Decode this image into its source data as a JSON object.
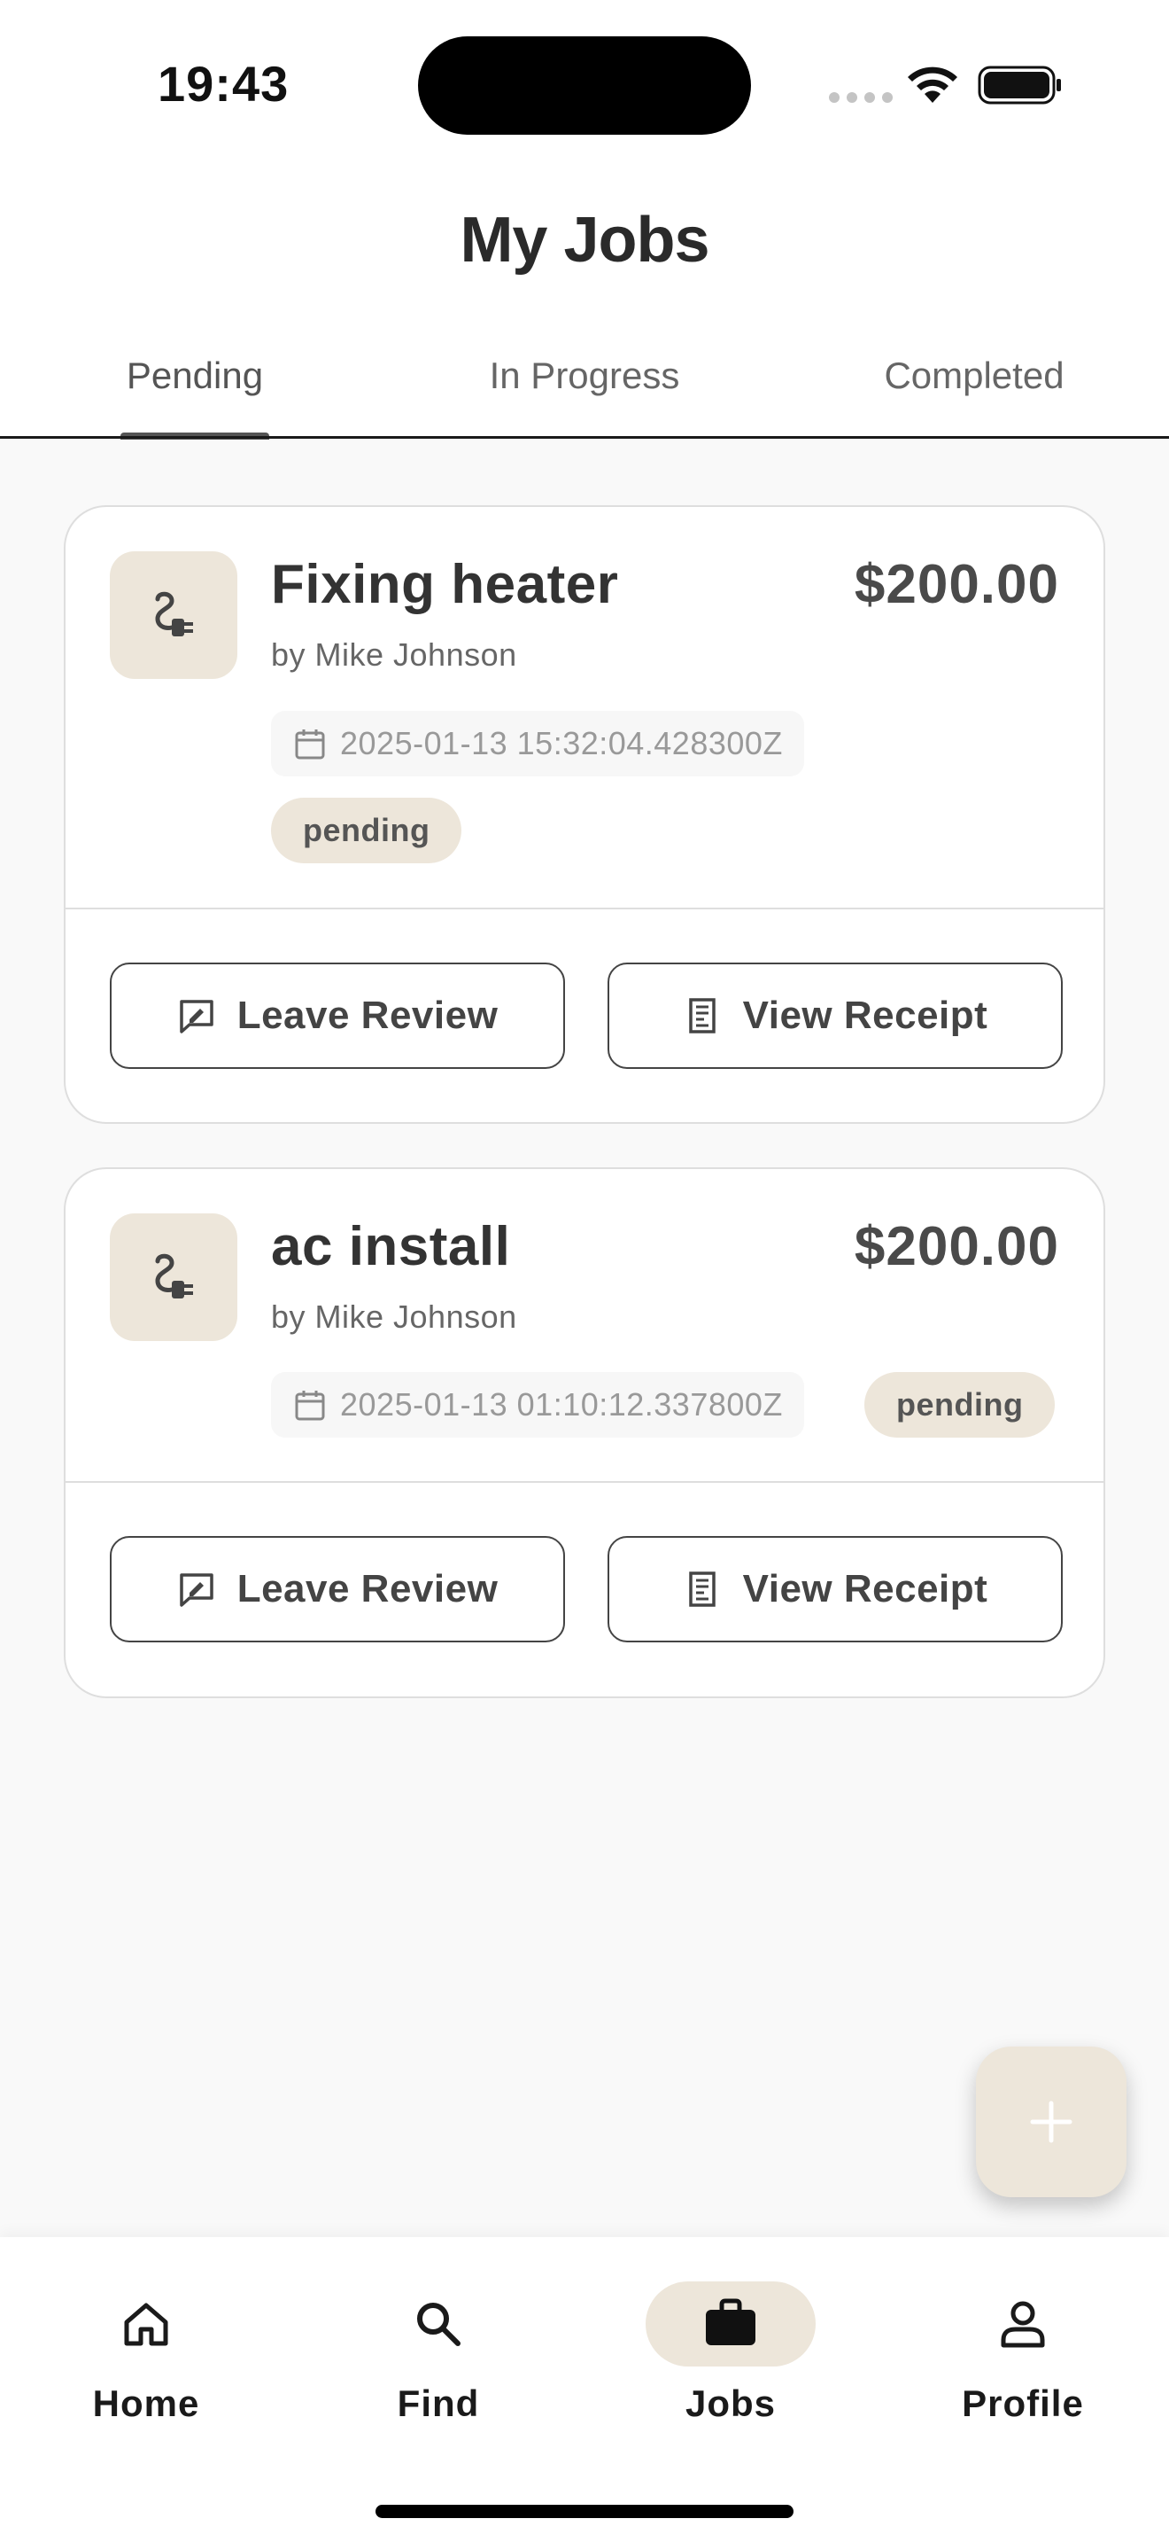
{
  "status_bar": {
    "time": "19:43"
  },
  "header": {
    "title": "My Jobs",
    "tabs": [
      {
        "label": "Pending",
        "active": true
      },
      {
        "label": "In Progress",
        "active": false
      },
      {
        "label": "Completed",
        "active": false
      }
    ]
  },
  "jobs": [
    {
      "icon": "plug-icon",
      "title": "Fixing heater",
      "price": "$200.00",
      "by": "by Mike Johnson",
      "date": "2025-01-13 15:32:04.428300Z",
      "status": "pending",
      "actions": {
        "review": "Leave Review",
        "receipt": "View Receipt"
      }
    },
    {
      "icon": "plug-icon",
      "title": "ac install",
      "price": "$200.00",
      "by": "by Mike Johnson",
      "date": "2025-01-13 01:10:12.337800Z",
      "status": "pending",
      "actions": {
        "review": "Leave Review",
        "receipt": "View Receipt"
      }
    }
  ],
  "fab": {
    "icon": "plus-icon"
  },
  "bottom_nav": {
    "items": [
      {
        "label": "Home",
        "icon": "home-icon",
        "active": false
      },
      {
        "label": "Find",
        "icon": "search-icon",
        "active": false
      },
      {
        "label": "Jobs",
        "icon": "briefcase-icon",
        "active": true
      },
      {
        "label": "Profile",
        "icon": "person-icon",
        "active": false
      }
    ]
  },
  "colors": {
    "accent_beige": "#ede6da",
    "text_dark": "#333333",
    "background": "#f9f9f9"
  }
}
